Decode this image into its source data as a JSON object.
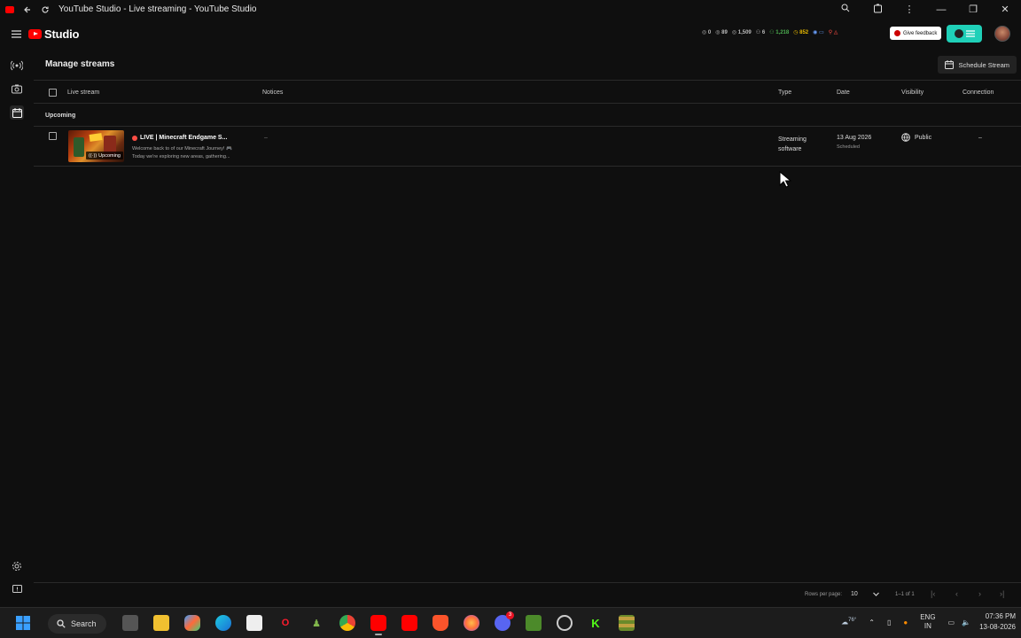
{
  "browser": {
    "tab_title": "YouTube Studio - Live streaming - YouTube Studio"
  },
  "app": {
    "logo_text": "Studio",
    "ext_stats": [
      "0",
      "89",
      "1,509",
      "6",
      "1,218",
      "852"
    ],
    "feedback_label": "Give feedback"
  },
  "page": {
    "title": "Manage streams",
    "schedule_button": "Schedule Stream"
  },
  "table": {
    "columns": {
      "live_stream": "Live stream",
      "notices": "Notices",
      "type": "Type",
      "date": "Date",
      "visibility": "Visibility",
      "connection": "Connection"
    },
    "section_label": "Upcoming",
    "rows": [
      {
        "title": "LIVE | Minecraft Endgame S...",
        "description_line1": "Welcome back to of our Minecraft Journey! 🎮",
        "description_line2": "Today we're exploring new areas, gathering...",
        "thumb_badge": "Upcoming",
        "notices": "–",
        "type_line1": "Streaming",
        "type_line2": "software",
        "date": "13 Aug 2026",
        "date_status": "Scheduled",
        "visibility": "Public",
        "connection": "–"
      }
    ]
  },
  "footer": {
    "rows_per_page_label": "Rows per page:",
    "rows_per_page_value": "10",
    "range": "1–1 of 1"
  },
  "taskbar": {
    "search_label": "Search",
    "weather": "76°",
    "lang_line1": "ENG",
    "lang_line2": "IN",
    "time": "07:36 PM",
    "date": "13-08-2026",
    "discord_badge": "3"
  },
  "colors": {
    "background": "#0f0f0f",
    "accent_red": "#ff0000",
    "live_dot": "#ff4e45",
    "ext_teal": "#1fd0b8"
  }
}
